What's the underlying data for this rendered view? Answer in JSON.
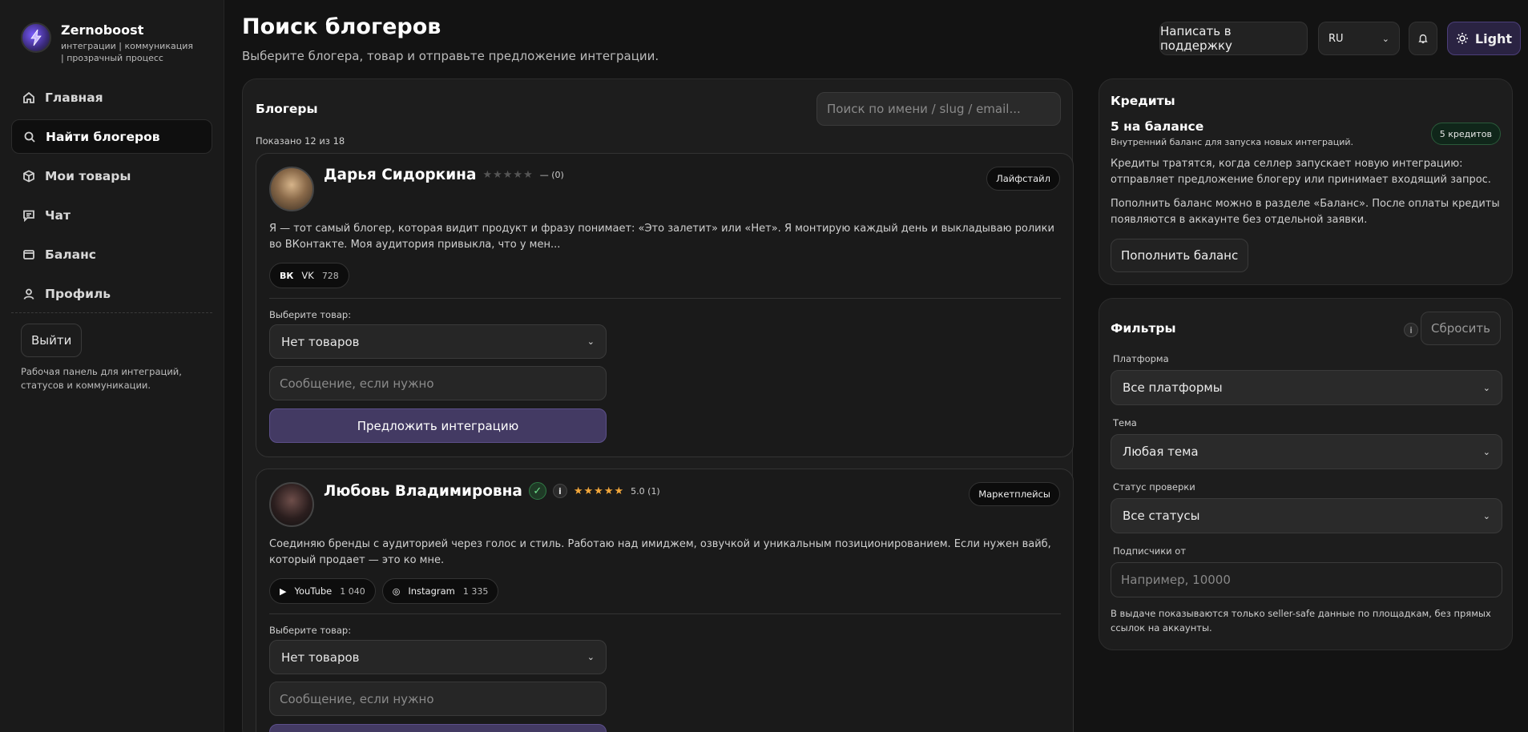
{
  "brand": {
    "name": "Zernoboost",
    "tagline": "интеграции | коммуникация | прозрачный процесс"
  },
  "sidebar": {
    "items": [
      {
        "label": "Главная",
        "icon": "home-icon"
      },
      {
        "label": "Найти блогеров",
        "icon": "search-icon",
        "active": true
      },
      {
        "label": "Мои товары",
        "icon": "box-icon"
      },
      {
        "label": "Чат",
        "icon": "chat-icon"
      },
      {
        "label": "Баланс",
        "icon": "wallet-icon"
      },
      {
        "label": "Профиль",
        "icon": "user-icon"
      }
    ],
    "logout_label": "Выйти",
    "note": "Рабочая панель для интеграций, статусов и коммуникации."
  },
  "header": {
    "title": "Поиск блогеров",
    "subtitle": "Выберите блогера, товар и отправьте предложение интеграции.",
    "support_label": "Написать в поддержку",
    "language": "RU",
    "theme_label": "Light"
  },
  "bloggers": {
    "title": "Блогеры",
    "search_placeholder": "Поиск по имени / slug / email...",
    "shown": "Показано 12 из 18",
    "select_label": "Выберите товар:",
    "select_value": "Нет товаров",
    "message_placeholder": "Сообщение, если нужно",
    "cta_label": "Предложить интеграцию",
    "cards": [
      {
        "name": "Дарья Сидоркина",
        "stars": "★★★★★",
        "rating_text": "— (0)",
        "tag": "Лайфстайл",
        "bio": "Я — тот самый блогер, которая видит продукт и фразу понимает: «Это залетит» или «Нет». Я монтирую каждый день и выкладываю ролики во ВКонтакте. Моя аудитория привыкла, что у мен...",
        "platforms": [
          {
            "icon": "vk-icon",
            "glyph": "ВК",
            "name": "VK",
            "count": "728"
          }
        ]
      },
      {
        "name": "Любовь Владимировна",
        "stars": "★★★★★",
        "rating_text": "5.0 (1)",
        "tag": "Маркетплейсы",
        "bio": "Соединяю бренды с аудиторией через голос и стиль. Работаю над имиджем, озвучкой и уникальным позиционированием. Если нужен вайб, который продает — это ко мне.",
        "platforms": [
          {
            "icon": "youtube-icon",
            "glyph": "▶",
            "name": "YouTube",
            "count": "1 040"
          },
          {
            "icon": "instagram-icon",
            "glyph": "◎",
            "name": "Instagram",
            "count": "1 335"
          }
        ]
      }
    ]
  },
  "credits": {
    "title": "Кредиты",
    "balance": "5 на балансе",
    "balance_sub": "Внутренний баланс для запуска новых интеграций.",
    "badge": "5 кредитов",
    "text1": "Кредиты тратятся, когда селлер запускает новую интеграцию: отправляет предложение блогеру или принимает входящий запрос.",
    "text2": "Пополнить баланс можно в разделе «Баланс». После оплаты кредиты появляются в аккаунте без отдельной заявки.",
    "topup_label": "Пополнить баланс"
  },
  "filters": {
    "title": "Фильтры",
    "reset_label": "Сбросить",
    "platform_label": "Платформа",
    "platform_value": "Все платформы",
    "topic_label": "Тема",
    "topic_value": "Любая тема",
    "status_label": "Статус проверки",
    "status_value": "Все статусы",
    "subs_label": "Подписчики от",
    "subs_placeholder": "Например, 10000",
    "note": "В выдаче показываются только seller-safe данные по площадкам, без прямых ссылок на аккаунты."
  },
  "colors": {
    "accent": "#433a63",
    "star": "#f2a73b",
    "verified": "#6fe08c"
  }
}
